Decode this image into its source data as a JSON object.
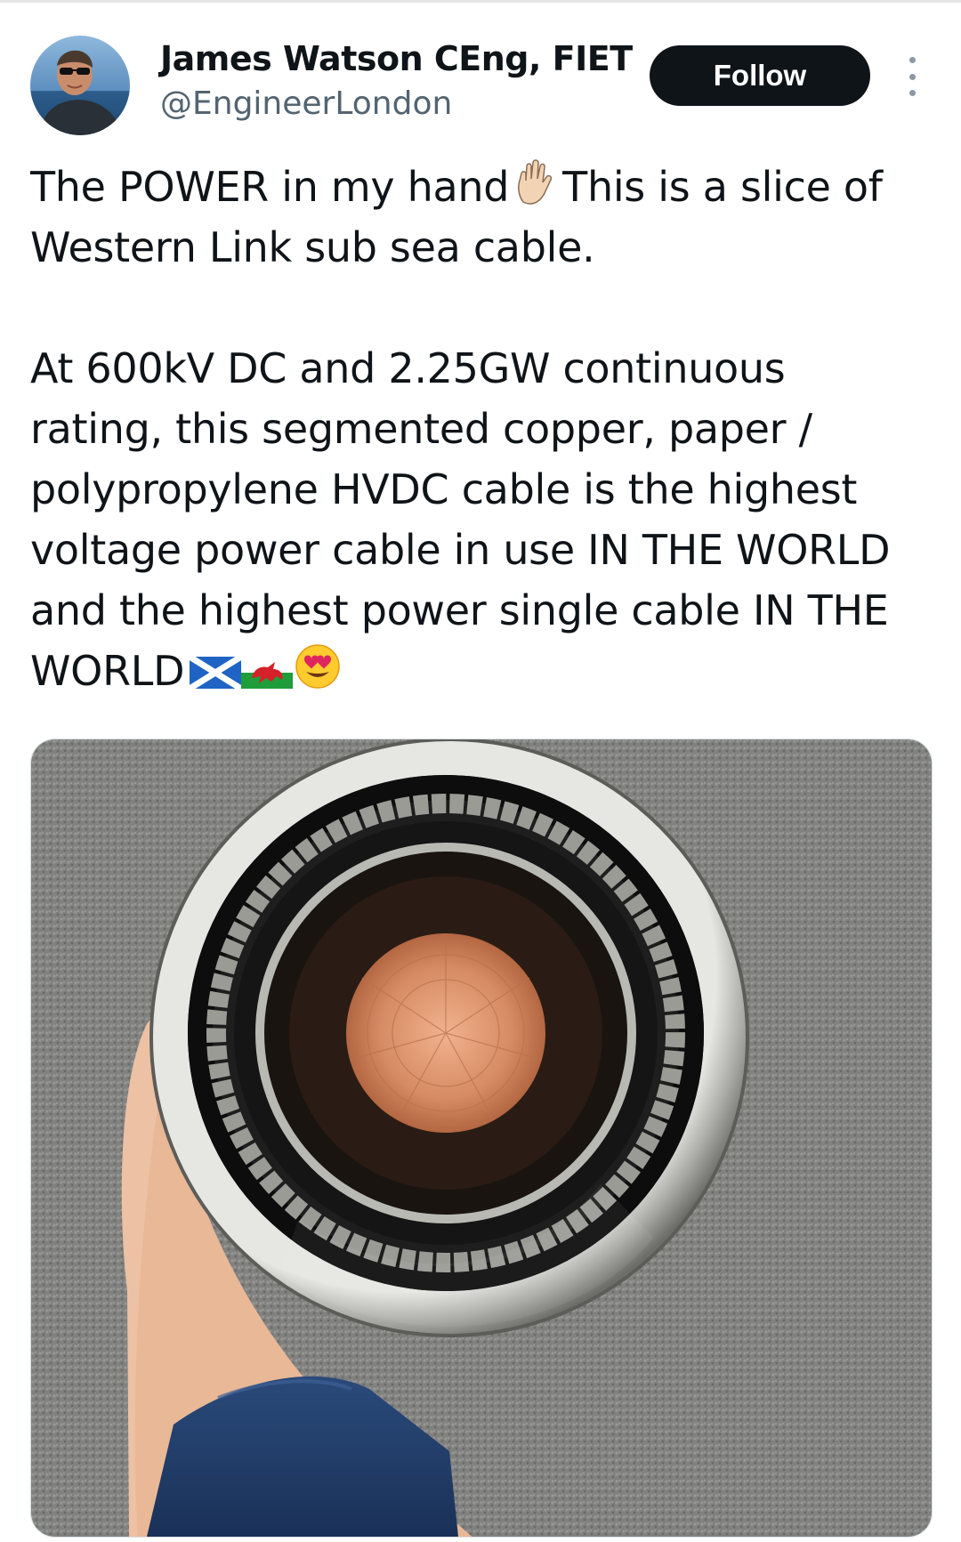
{
  "author": {
    "name": "James Watson CEng, FIET",
    "handle": "@EngineerLondon"
  },
  "actions": {
    "follow_label": "Follow"
  },
  "tweet": {
    "line1a": "The POWER in my hand",
    "line1b": "This is a slice of",
    "line2": "Western Link sub sea cable.",
    "line3": "At 600kV DC and 2.25GW continuous",
    "line4": "rating, this segmented copper, paper /",
    "line5": "polypropylene HVDC cable is the highest",
    "line6": "voltage power cable in use IN THE WORLD",
    "line7": "and the highest power single cable IN THE",
    "line8": "WORLD"
  },
  "icons": {
    "hand": "raised-hand-emoji",
    "flag1": "scotland-flag-emoji",
    "flag2": "wales-flag-emoji",
    "face": "heart-eyes-emoji",
    "more": "more-vertical-icon"
  },
  "colors": {
    "text": "#0f1419",
    "secondary": "#536471",
    "button_bg": "#0f1419",
    "copper": "#d2835a"
  }
}
